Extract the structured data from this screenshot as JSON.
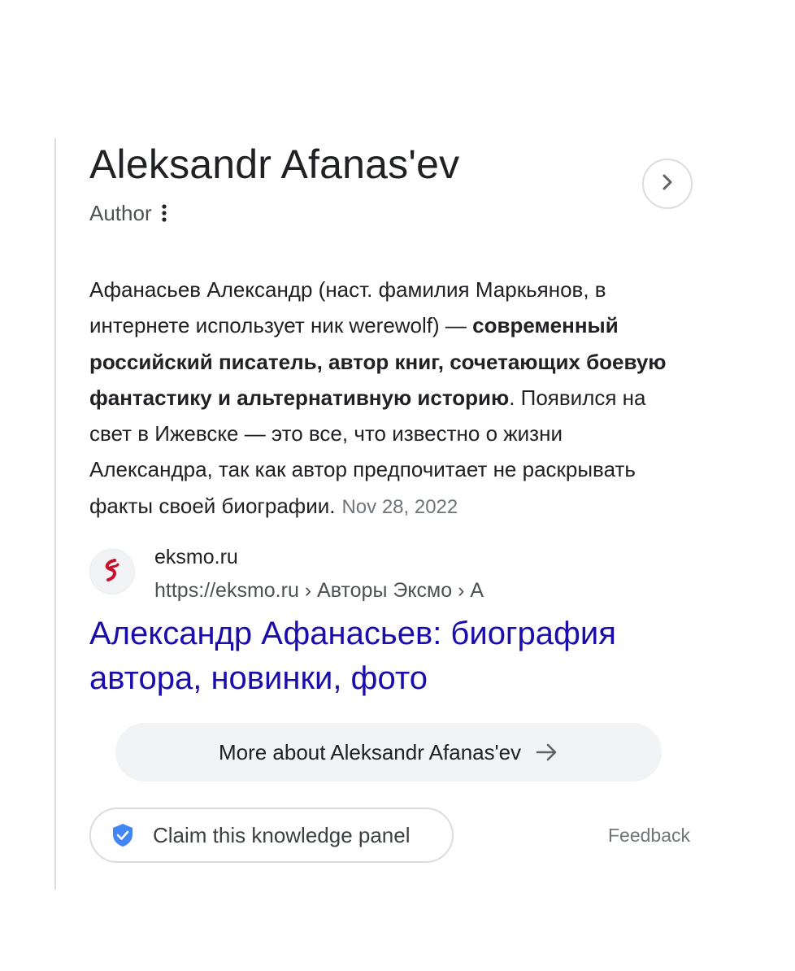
{
  "header": {
    "title": "Aleksandr Afanas'ev",
    "subtitle": "Author"
  },
  "description": {
    "intro": "Афанасьев Александр (наст. фамилия Маркьянов, в интернете использует ник werewolf) — ",
    "bold": "современный российский писатель, автор книг, сочетающих боевую фантастику и альтернативную историю",
    "outro": ". Появился на свет в Ижевске — это все, что известно о жизни Александра, так как автор предпочитает не раскрывать факты своей биографии.",
    "date": "Nov 28, 2022"
  },
  "source": {
    "name": "eksmo.ru",
    "url": "https://eksmo.ru › Авторы Эксмо › А",
    "favicon_color": "#c8102e"
  },
  "result": {
    "link_text": "Александр Афанасьев: биография автора, новинки, фото"
  },
  "actions": {
    "more_label": "More about Aleksandr Afanas'ev",
    "claim_label": "Claim this knowledge panel",
    "feedback_label": "Feedback"
  },
  "colors": {
    "link": "#1a0dab",
    "shield": "#4285f4",
    "secondary_text": "#70757a"
  }
}
